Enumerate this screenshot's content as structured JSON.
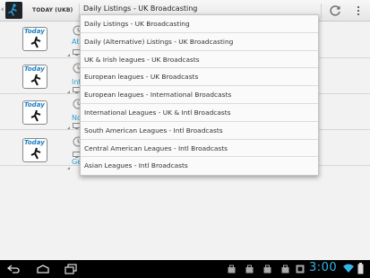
{
  "action_bar": {
    "nav_label": "TODAY (UKB)",
    "spinner_value": "Daily Listings - UK Broadcasting",
    "icons": [
      "refresh-icon",
      "overflow-menu-icon"
    ]
  },
  "list": {
    "rows": [
      {
        "logo_text": "Today",
        "link_text": "Ath"
      },
      {
        "logo_text": "Today",
        "link_text": "Inte"
      },
      {
        "logo_text": "Today",
        "link_text": "Nor"
      },
      {
        "logo_text": "Today",
        "link_text": "Ger"
      }
    ]
  },
  "dropdown": {
    "options": [
      "Daily Listings - UK Broadcasting",
      "Daily (Alternative) Listings - UK Broadcasting",
      "UK & Irish leagues - UK Broadcasts",
      "European leagues - UK Broadcasts",
      "European leagues - International Broadcasts",
      "International Leagues - UK & Intl Broadcasts",
      "South American Leagues - Intl Broadcasts",
      "Central American Leagues - Intl Broadcasts",
      "Asian Leagues - Intl Broadcasts"
    ]
  },
  "system_bar": {
    "time": "3:00",
    "colors": {
      "clock": "#33b5e5"
    }
  }
}
